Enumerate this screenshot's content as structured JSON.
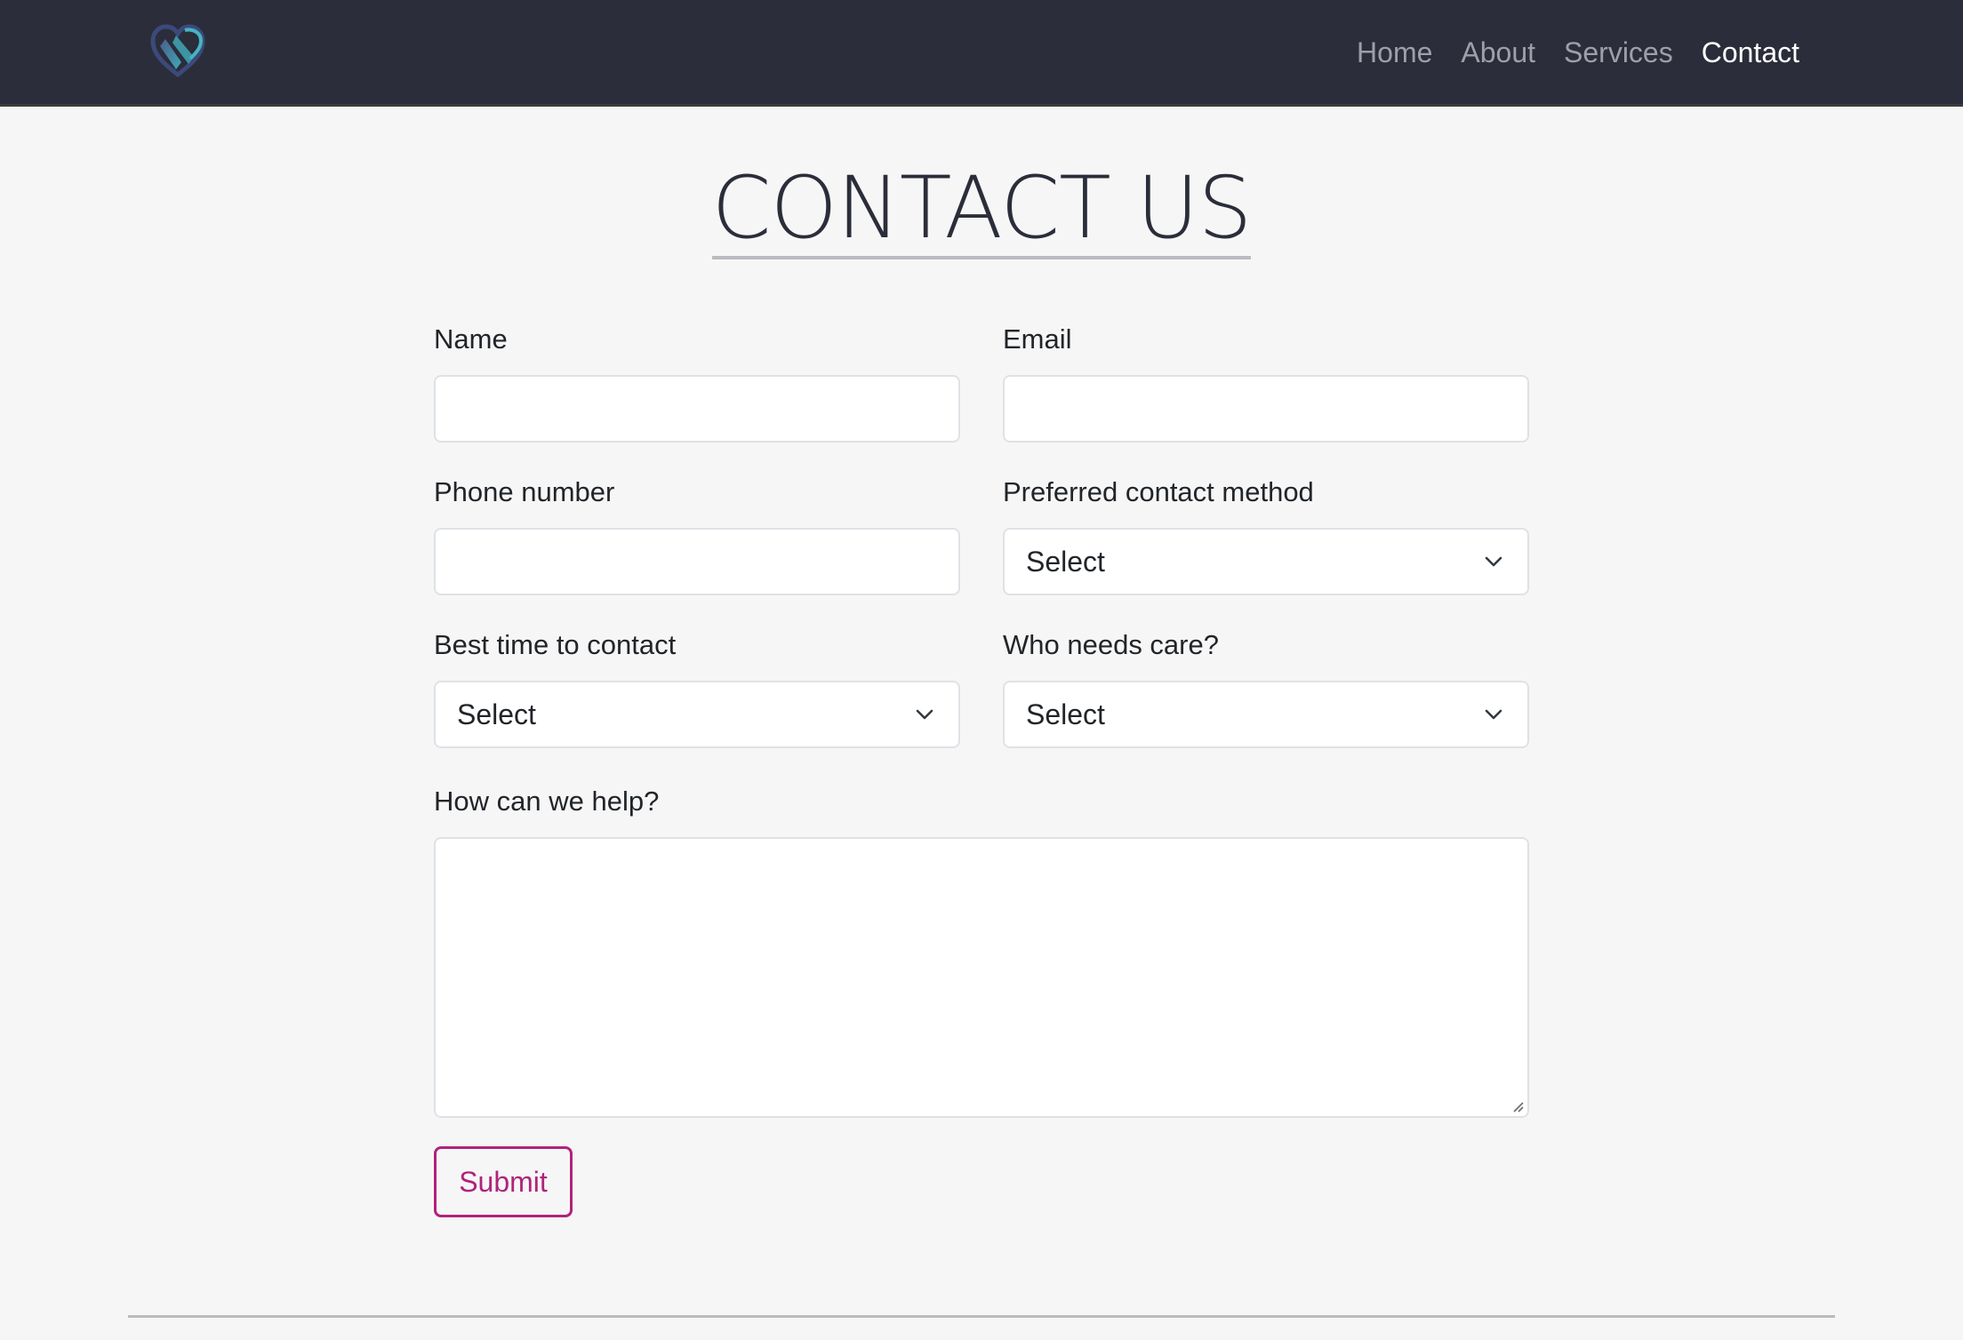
{
  "nav": {
    "links": [
      {
        "label": "Home",
        "active": false
      },
      {
        "label": "About",
        "active": false
      },
      {
        "label": "Services",
        "active": false
      },
      {
        "label": "Contact",
        "active": true
      }
    ]
  },
  "page": {
    "title": "CONTACT US"
  },
  "form": {
    "name": {
      "label": "Name",
      "value": ""
    },
    "email": {
      "label": "Email",
      "value": ""
    },
    "phone": {
      "label": "Phone number",
      "value": ""
    },
    "contact_method": {
      "label": "Preferred contact method",
      "selected": "Select"
    },
    "best_time": {
      "label": "Best time to contact",
      "selected": "Select"
    },
    "who_needs_care": {
      "label": "Who needs care?",
      "selected": "Select"
    },
    "message": {
      "label": "How can we help?",
      "value": ""
    },
    "submit_label": "Submit"
  },
  "colors": {
    "navbar_bg": "#2b2d3a",
    "page_bg": "#f6f6f6",
    "accent": "#b0237a",
    "logo_teal": "#3fa7b8",
    "logo_navy": "#3b4a7a"
  }
}
